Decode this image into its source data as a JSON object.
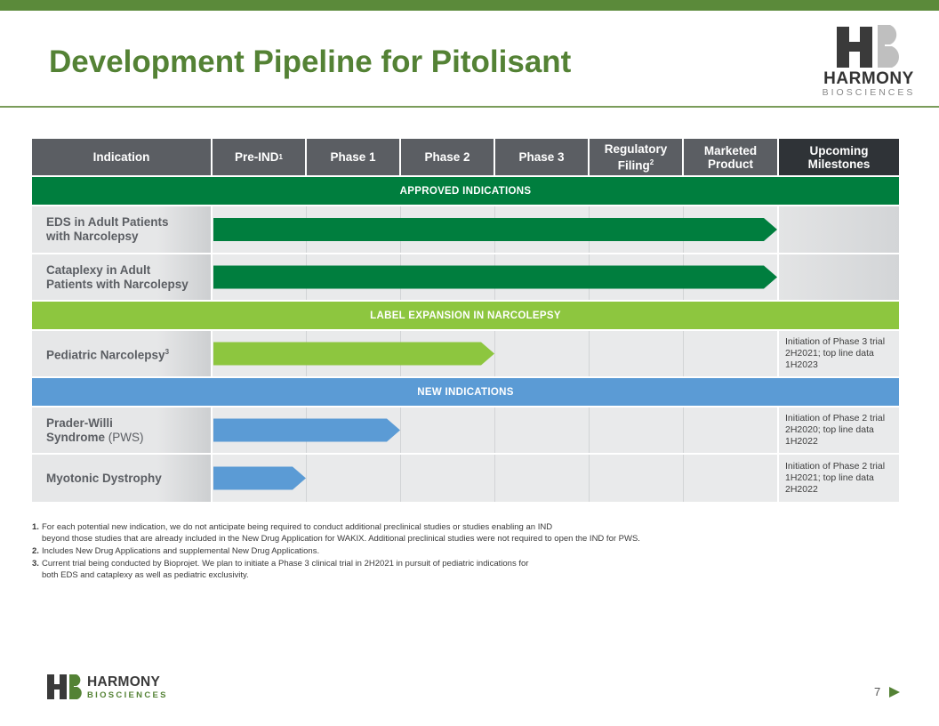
{
  "title": "Development Pipeline for Pitolisant",
  "logo": {
    "name": "HARMONY",
    "sub": "BIOSCIENCES"
  },
  "headers": {
    "indication": "Indication",
    "preind": "Pre-IND",
    "preind_sup": "1",
    "phase1": "Phase 1",
    "phase2": "Phase 2",
    "phase3": "Phase 3",
    "regulatory_line1": "Regulatory",
    "regulatory_line2": "Filing",
    "regulatory_sup": "2",
    "marketed_line1": "Marketed",
    "marketed_line2": "Product",
    "upcoming_line1": "Upcoming",
    "upcoming_line2": "Milestones"
  },
  "sections": {
    "approved": "APPROVED INDICATIONS",
    "label_expansion": "LABEL EXPANSION IN NARCOLEPSY",
    "new": "NEW INDICATIONS"
  },
  "rows": {
    "eds": {
      "line1": "EDS in Adult Patients",
      "line2": "with Narcolepsy",
      "milestone": ""
    },
    "cataplexy": {
      "line1": "Cataplexy in Adult",
      "line2": "Patients with Narcolepsy",
      "milestone": ""
    },
    "pediatric": {
      "label": "Pediatric Narcolepsy",
      "sup": "3",
      "milestone": "Initiation of Phase 3 trial 2H2021; top line data 1H2023"
    },
    "pws": {
      "line1": "Prader-Willi",
      "line2a": "Syndrome",
      "line2b": " (PWS)",
      "milestone": "Initiation of Phase 2 trial 2H2020; top line data 1H2022"
    },
    "myotonic": {
      "label": "Myotonic Dystrophy",
      "milestone": "Initiation of Phase 2 trial 1H2021; top line data 2H2022"
    }
  },
  "progress_columns": {
    "eds": 6,
    "cataplexy": 6,
    "pediatric": 3,
    "pws": 2,
    "myotonic": 1
  },
  "colors": {
    "approved": "#007e3e",
    "label_expansion": "#8dc63f",
    "new": "#5b9bd5",
    "title": "#548235"
  },
  "footnotes": [
    {
      "num": "1.",
      "line1": "For each potential new indication, we do not anticipate being required to conduct additional preclinical studies or studies enabling an IND",
      "line2": "beyond those studies that are already included in the New Drug Application for WAKIX. Additional preclinical studies were not required to open the IND for PWS."
    },
    {
      "num": "2.",
      "line1": "Includes New Drug Applications and supplemental New Drug Applications.",
      "line2": ""
    },
    {
      "num": "3.",
      "line1": "Current trial being conducted by Bioprojet.  We plan to initiate a Phase 3 clinical trial in 2H2021 in pursuit of pediatric indications for",
      "line2": "both EDS and cataplexy as well as pediatric exclusivity."
    }
  ],
  "page_number": "7",
  "icons": {
    "next": "triangle-right-icon"
  }
}
